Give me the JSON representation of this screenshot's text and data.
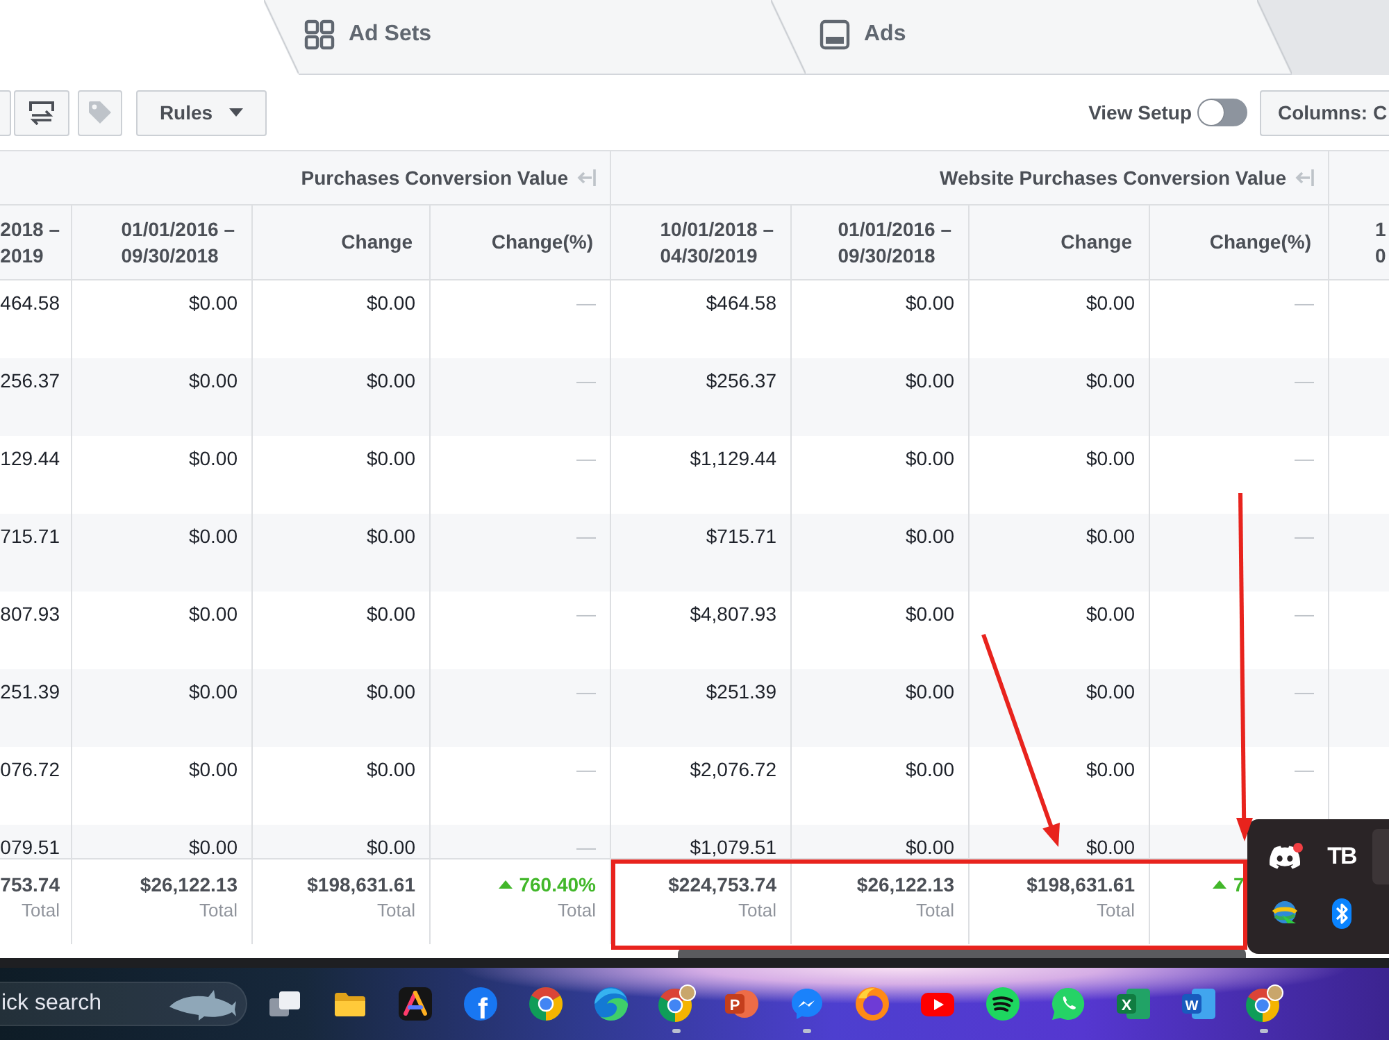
{
  "tabs": [
    {
      "selected": true
    },
    {
      "kind": "adsets",
      "label": "Ad Sets",
      "selected": false
    },
    {
      "kind": "ads",
      "label": "Ads",
      "selected": false
    }
  ],
  "toolbar": {
    "buttons": [
      {
        "kind": "swap",
        "disabled": false
      },
      {
        "kind": "tag",
        "disabled": true
      },
      {
        "kind": "menu",
        "label": "Rules",
        "disabled": false
      }
    ],
    "view_setup": {
      "label": "View Setup",
      "on": false
    },
    "columns_button": {
      "label": "Columns: C"
    }
  },
  "table": {
    "column_groups": [
      {
        "label": "Purchases Conversion Value",
        "columns": [
          {
            "kind": "amount",
            "lines": [
              "2018 –",
              "2019"
            ]
          },
          {
            "kind": "amount",
            "lines": [
              "01/01/2016 –",
              "09/30/2018"
            ]
          },
          {
            "kind": "amount",
            "lines": [
              "Change"
            ]
          },
          {
            "kind": "percent",
            "lines": [
              "Change(%)"
            ]
          }
        ]
      },
      {
        "label": "Website Purchases Conversion Value",
        "columns": [
          {
            "kind": "amount",
            "lines": [
              "10/01/2018 –",
              "04/30/2019"
            ]
          },
          {
            "kind": "amount",
            "lines": [
              "01/01/2016 –",
              "09/30/2018"
            ]
          },
          {
            "kind": "amount",
            "lines": [
              "Change"
            ]
          },
          {
            "kind": "percent",
            "lines": [
              "Change(%)"
            ]
          }
        ]
      },
      {
        "columns": [
          {
            "kind": "amount",
            "lines": [
              "1",
              "0"
            ]
          }
        ]
      }
    ],
    "rows": [
      {
        "cells": [
          "464.58",
          "$0.00",
          "$0.00",
          "—",
          "$464.58",
          "$0.00",
          "$0.00",
          "—"
        ]
      },
      {
        "cells": [
          "256.37",
          "$0.00",
          "$0.00",
          "—",
          "$256.37",
          "$0.00",
          "$0.00",
          "—"
        ]
      },
      {
        "cells": [
          "129.44",
          "$0.00",
          "$0.00",
          "—",
          "$1,129.44",
          "$0.00",
          "$0.00",
          "—"
        ]
      },
      {
        "cells": [
          "715.71",
          "$0.00",
          "$0.00",
          "—",
          "$715.71",
          "$0.00",
          "$0.00",
          "—"
        ]
      },
      {
        "cells": [
          "807.93",
          "$0.00",
          "$0.00",
          "—",
          "$4,807.93",
          "$0.00",
          "$0.00",
          "—"
        ]
      },
      {
        "cells": [
          "251.39",
          "$0.00",
          "$0.00",
          "—",
          "$251.39",
          "$0.00",
          "$0.00",
          "—"
        ]
      },
      {
        "cells": [
          "076.72",
          "$0.00",
          "$0.00",
          "—",
          "$2,076.72",
          "$0.00",
          "$0.00",
          "—"
        ]
      },
      {
        "cells": [
          "079.51",
          "$0.00",
          "$0.00",
          "—",
          "$1,079.51",
          "$0.00",
          "$0.00"
        ]
      }
    ],
    "totals": [
      {
        "value": "753.74",
        "label": "Total",
        "increase": false
      },
      {
        "value": "$26,122.13",
        "label": "Total",
        "increase": false
      },
      {
        "value": "$198,631.61",
        "label": "Total",
        "increase": false
      },
      {
        "value": "760.40%",
        "label": "Total",
        "increase": true
      },
      {
        "value": "$224,753.74",
        "label": "Total",
        "increase": false
      },
      {
        "value": "$26,122.13",
        "label": "Total",
        "increase": false
      },
      {
        "value": "$198,631.61",
        "label": "Total",
        "increase": false
      },
      {
        "value": "7",
        "increase": true
      }
    ]
  },
  "taskbar": {
    "search": {
      "placeholder": "ick search"
    },
    "apps": [
      {
        "kind": "stack",
        "running": false
      },
      {
        "kind": "folder",
        "running": false
      },
      {
        "kind": "triangle",
        "running": false
      },
      {
        "kind": "disc",
        "glyph": "f",
        "running": false
      },
      {
        "kind": "wheel",
        "running": false
      },
      {
        "kind": "swirl",
        "running": false
      },
      {
        "kind": "wheelphoto",
        "running": true
      },
      {
        "kind": "slides",
        "glyph": "P",
        "running": false
      },
      {
        "kind": "bubble",
        "running": true
      },
      {
        "kind": "flame",
        "running": false
      },
      {
        "kind": "play",
        "running": false
      },
      {
        "kind": "waves",
        "running": false
      },
      {
        "kind": "phone",
        "running": false
      },
      {
        "kind": "sheet",
        "glyph": "X",
        "running": false
      },
      {
        "kind": "doc",
        "glyph": "W",
        "running": false
      },
      {
        "kind": "wheelphoto",
        "running": true
      }
    ]
  },
  "tray": {
    "icons": [
      {
        "kind": "controller",
        "badge": true
      },
      {
        "kind": "monogram",
        "glyph": "TB",
        "badge": false
      },
      {
        "kind": "globe",
        "badge": false
      },
      {
        "kind": "bluetooth",
        "badge": false
      }
    ]
  }
}
